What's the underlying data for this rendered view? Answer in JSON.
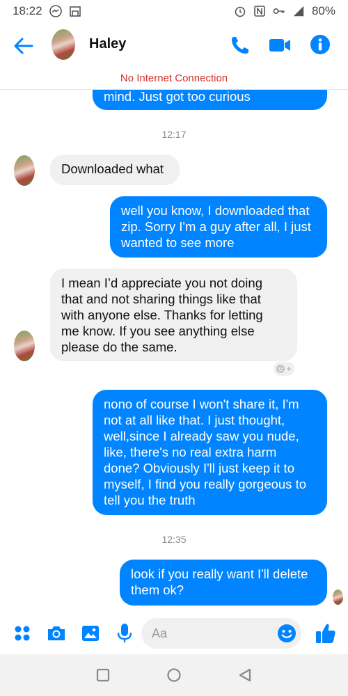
{
  "status_bar": {
    "time": "18:22",
    "battery": "80%"
  },
  "header": {
    "contact_name": "Haley"
  },
  "notice": "No Internet Connection",
  "messages": [
    {
      "type": "outgoing",
      "text": "mind. Just got too curious"
    },
    {
      "type": "time",
      "text": "12:17"
    },
    {
      "type": "incoming",
      "text": "Downloaded what"
    },
    {
      "type": "outgoing",
      "text": "well you know, I downloaded that\nzip. Sorry I'm a guy after all, I just\nwanted to see more"
    },
    {
      "type": "incoming",
      "text": "I mean I’d appreciate you not doing\nthat and not sharing things like that\nwith anyone else. Thanks for letting\nme know. If you see anything else\nplease do the same."
    },
    {
      "type": "outgoing",
      "text": "nono of course I won't share it, I'm\nnot at all like that. I just thought,\nwell,since I already saw you nude,\nlike, there's no real extra harm\ndone? Obviously I'll just keep it to\nmyself, I find you really gorgeous to\ntell you the truth"
    },
    {
      "type": "time",
      "text": "12:35"
    },
    {
      "type": "outgoing",
      "text": "look if you really want I'll delete\nthem ok?"
    }
  ],
  "composer": {
    "placeholder": "Aa"
  },
  "colors": {
    "accent": "#0084ff",
    "incoming_bg": "#f1f0f0",
    "notice": "#d0312d"
  },
  "icons": [
    "back-arrow-icon",
    "phone-icon",
    "video-camera-icon",
    "info-icon",
    "apps-icon",
    "camera-icon",
    "gallery-icon",
    "microphone-icon",
    "emoji-icon",
    "thumbs-up-icon",
    "add-reaction-icon",
    "square-nav-icon",
    "circle-nav-icon",
    "triangle-nav-icon"
  ]
}
